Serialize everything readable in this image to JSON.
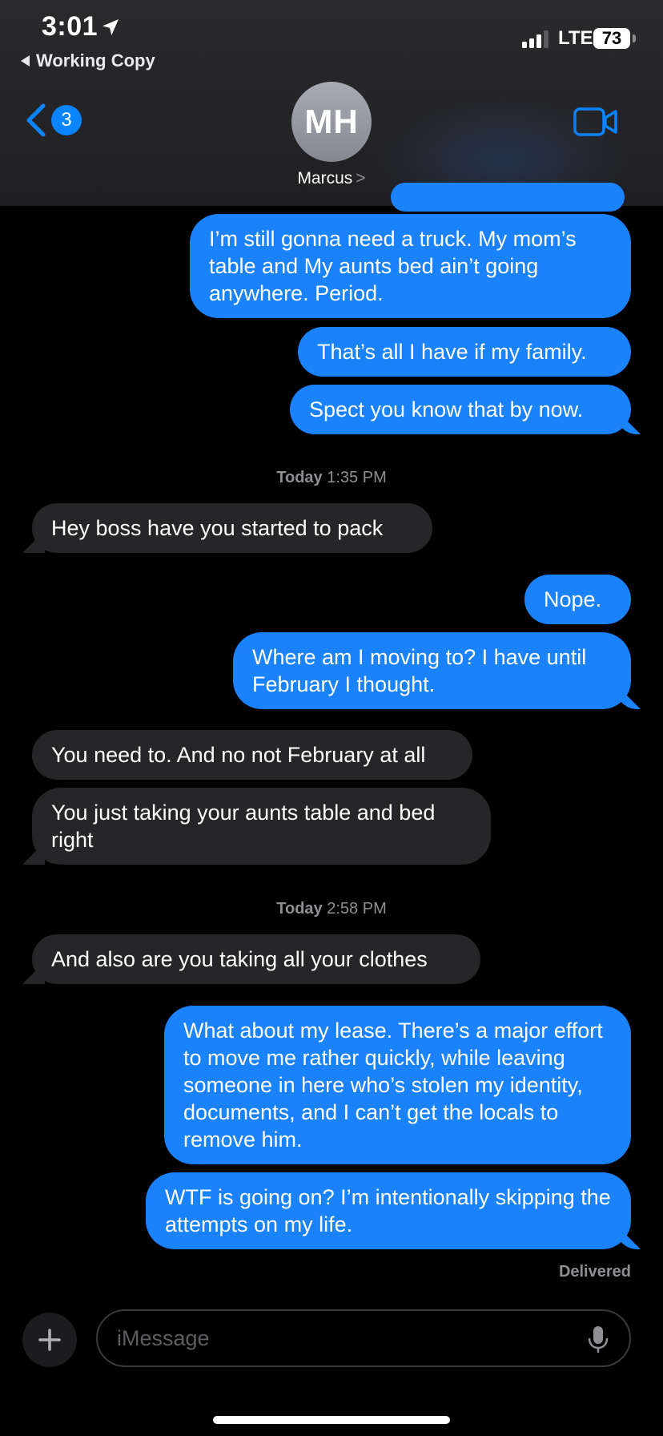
{
  "status_bar": {
    "time": "3:01",
    "back_app": "Working Copy",
    "network": "LTE",
    "battery": "73"
  },
  "header": {
    "back_badge": "3",
    "avatar_initials": "MH",
    "contact_name": "Marcus",
    "chevron": ">"
  },
  "messages": [
    {
      "side": "sent",
      "text": "I’m still gonna need a truck. My mom’s table and My aunts bed ain’t going anywhere. Period."
    },
    {
      "side": "sent",
      "text": "That’s all I have if my family."
    },
    {
      "side": "sent",
      "text": "Spect you know that by now."
    },
    {
      "side": "recv",
      "text": "Hey boss have you started to pack"
    },
    {
      "side": "sent",
      "text": "Nope."
    },
    {
      "side": "sent",
      "text": "Where am I moving to? I have until February I thought."
    },
    {
      "side": "recv",
      "text": "You need to. And no not February at all"
    },
    {
      "side": "recv",
      "text": "You just taking your aunts table and bed right"
    },
    {
      "side": "recv",
      "text": "And also are you taking all your clothes"
    },
    {
      "side": "sent",
      "text": "What about my lease. There’s a major effort to move me rather quickly, while leaving someone in here who’s stolen my identity, documents, and I can’t get the locals to remove him."
    },
    {
      "side": "sent",
      "text": "WTF is going on? I’m intentionally skipping the attempts on my life."
    }
  ],
  "timestamps": [
    {
      "day": "Today",
      "time": "1:35 PM"
    },
    {
      "day": "Today",
      "time": "2:58 PM"
    }
  ],
  "delivered": "Delivered",
  "composer": {
    "placeholder": "iMessage"
  }
}
